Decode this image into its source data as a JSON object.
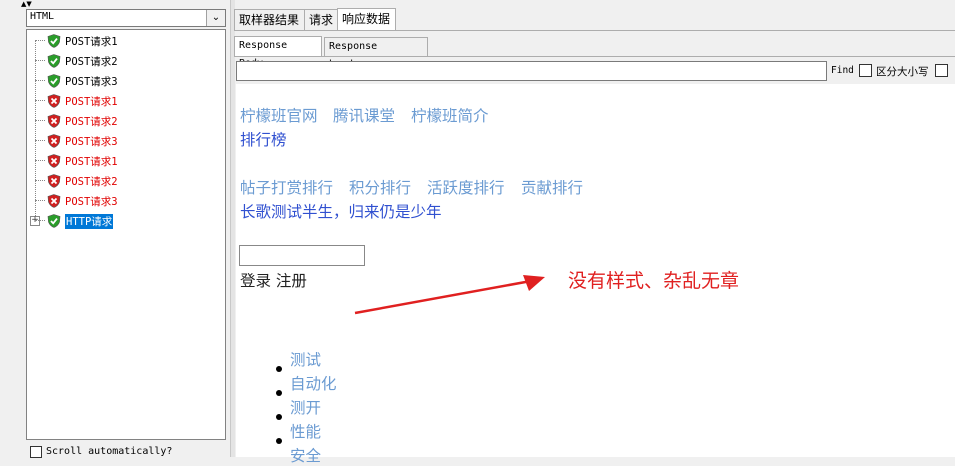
{
  "left_panel": {
    "combo_value": "HTML",
    "tree_items": [
      {
        "label": "POST请求1",
        "status": "ok"
      },
      {
        "label": "POST请求2",
        "status": "ok"
      },
      {
        "label": "POST请求3",
        "status": "ok"
      },
      {
        "label": "POST请求1",
        "status": "err"
      },
      {
        "label": "POST请求2",
        "status": "err"
      },
      {
        "label": "POST请求3",
        "status": "err"
      },
      {
        "label": "POST请求1",
        "status": "err"
      },
      {
        "label": "POST请求2",
        "status": "err"
      },
      {
        "label": "POST请求3",
        "status": "err"
      },
      {
        "label": "HTTP请求",
        "status": "ok",
        "selected": true
      }
    ],
    "scroll_label": "Scroll automatically?"
  },
  "tabs": [
    "取样器结果",
    "请求",
    "响应数据"
  ],
  "sub_tabs": [
    "Response Body",
    "Response headers"
  ],
  "find": {
    "label": "Find",
    "case_label": "区分大小写"
  },
  "content": {
    "nav_links": [
      "柠檬班官网",
      "腾讯课堂",
      "柠檬班简介"
    ],
    "ranking": "排行榜",
    "rank_links": [
      "帖子打赏排行",
      "积分排行",
      "活跃度排行",
      "贡献排行"
    ],
    "slogan": "长歌测试半生，归来仍是少年",
    "login_text": "登录 注册",
    "list_items": [
      "测试",
      "自动化",
      "测开",
      "性能",
      "安全"
    ]
  },
  "annotation": "没有样式、杂乱无章",
  "colors": {
    "ok": "#2a9d2a",
    "err": "#d02020",
    "annotation": "#e02020",
    "link": "#6b9bd2",
    "selected": "#0078d7"
  }
}
